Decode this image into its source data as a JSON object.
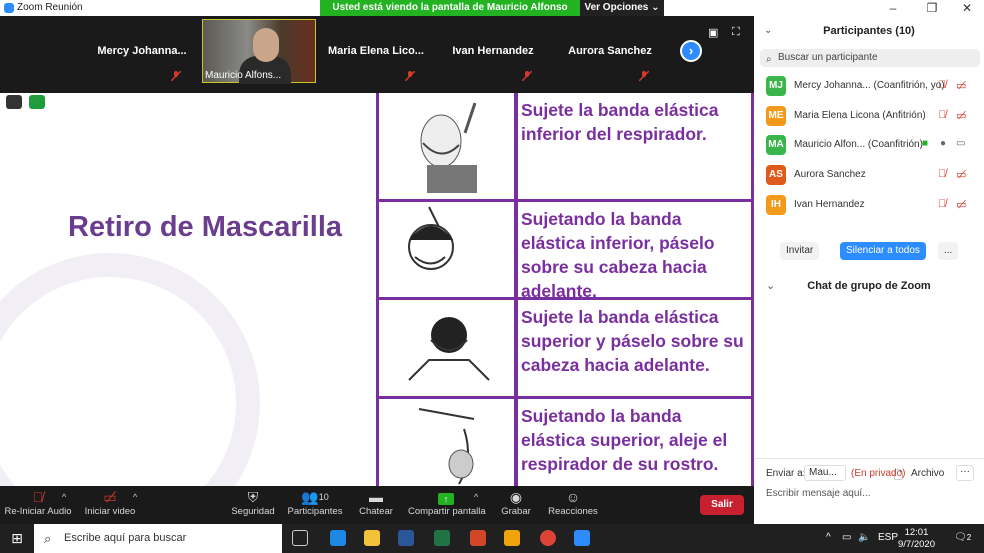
{
  "window": {
    "title": "Zoom Reunión"
  },
  "banner": {
    "text": "Usted está viendo la pantalla de Mauricio Alfonso Aguilar",
    "view_options": "Ver Opciones ⌄"
  },
  "strip": {
    "tiles": [
      {
        "name": "Mercy  Johanna..."
      },
      {
        "name": "Mauricio Alfons..."
      },
      {
        "name": "Maria  Elena  Lico..."
      },
      {
        "name": "Ivan Hernandez"
      },
      {
        "name": "Aurora Sanchez"
      }
    ]
  },
  "slide": {
    "title": "Retiro de Mascarilla",
    "steps": [
      {
        "text": "Sujete la banda elástica inferior del respirador."
      },
      {
        "text": "Sujetando la banda elástica inferior, páselo sobre su cabeza hacia adelante."
      },
      {
        "text": "Sujete la banda elástica superior y páselo sobre su cabeza hacia adelante."
      },
      {
        "text": "Sujetando la banda elástica superior, aleje el respirador de su rostro."
      }
    ]
  },
  "panel": {
    "title": "Participantes (10)",
    "search_placeholder": "Buscar un participante",
    "participants": [
      {
        "initials": "MJ",
        "name": "Mercy Johanna... (Coanfitrión, yo)",
        "color": "#39b54a"
      },
      {
        "initials": "ME",
        "name": "Maria Elena Licona (Anfitrión)",
        "color": "#f39a1b"
      },
      {
        "initials": "MA",
        "name": "Mauricio Alfon... (Coanfitrión)",
        "color": "#39b54a"
      },
      {
        "initials": "AS",
        "name": "Aurora Sanchez",
        "color": "#e05a1b"
      },
      {
        "initials": "IH",
        "name": "Ivan Hernandez",
        "color": "#f39a1b"
      }
    ],
    "invite": "Invitar",
    "mute_all": "Silenciar a todos",
    "more": "...",
    "chat_title": "Chat de grupo de Zoom",
    "send_to": "Enviar a:",
    "send_target": "Mau...",
    "private": "(En privado)",
    "file": "Archivo",
    "chat_placeholder": "Escribir mensaje aquí..."
  },
  "toolbar": {
    "audio": "Re-Iniciar Audio",
    "video": "Iniciar video",
    "security": "Seguridad",
    "participants": "Participantes",
    "participants_count": "10",
    "chat": "Chatear",
    "share": "Compartir pantalla",
    "record": "Grabar",
    "reactions": "Reacciones",
    "leave": "Salir"
  },
  "taskbar": {
    "search": "Escribe aquí para buscar",
    "lang": "ESP",
    "time": "12:01",
    "date": "9/7/2020",
    "notif_count": "2"
  },
  "colors": {
    "accent": "#2d8cff",
    "slide_purple": "#7a2fa0",
    "leave_red": "#c8202f",
    "banner_green": "#22b222"
  }
}
